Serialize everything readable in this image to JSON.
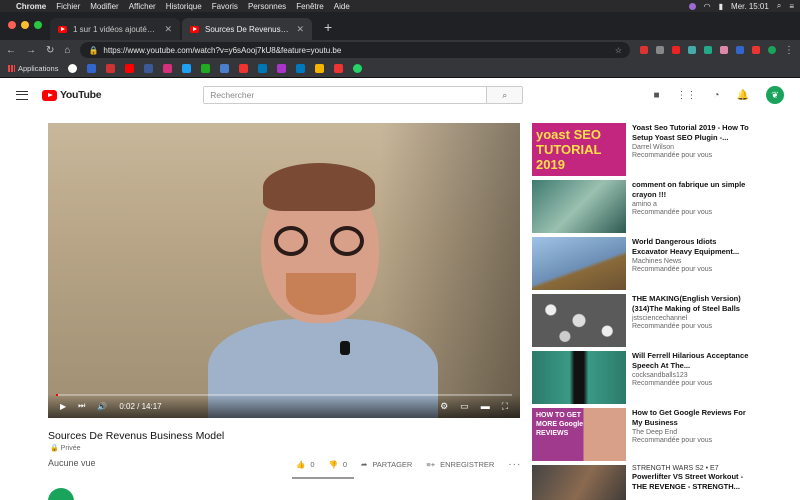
{
  "menubar": {
    "app": "Chrome",
    "items": [
      "Fichier",
      "Modifier",
      "Afficher",
      "Historique",
      "Favoris",
      "Personnes",
      "Fenêtre",
      "Aide"
    ],
    "clock": "Mer. 15:01"
  },
  "tabs": [
    {
      "title": "1 sur 1 vidéos ajoutées - YouTube"
    },
    {
      "title": "Sources De Revenus Business Model - YouTube"
    }
  ],
  "toolbar": {
    "url": "https://www.youtube.com/watch?v=y6sAooj7kU8&feature=youtu.be"
  },
  "bookmarks": {
    "apps_label": "Applications"
  },
  "youtube": {
    "logo_text": "YouTube",
    "search_placeholder": "Rechercher",
    "avatar_letter": "●"
  },
  "player": {
    "time": "0:02 / 14:17",
    "progress": 0.002
  },
  "video": {
    "title": "Sources De Revenus Business Model",
    "privacy": "Privée",
    "views": "Aucune vue",
    "likes": "0",
    "dislikes": "0",
    "share_label": "PARTAGER",
    "save_label": "ENREGISTRER"
  },
  "recommendations": [
    {
      "title": "Yoast Seo Tutorial 2019 - How To Setup Yoast SEO Plugin -...",
      "channel": "Darrel Wilson",
      "meta": "Recommandée pour vous",
      "thumb_text": "yoast SEO TUTORIAL 2019",
      "thumb_color": "#c2267e"
    },
    {
      "title": "comment on fabrique un simple crayon !!!",
      "channel": "amino a",
      "meta": "Recommandée pour vous",
      "thumb_text": "",
      "thumb_color": "#4c8a7c"
    },
    {
      "title": "World Dangerous Idiots Excavator Heavy Equipment...",
      "channel": "Machines News",
      "meta": "Recommandée pour vous",
      "thumb_text": "",
      "thumb_color": "#7aa2c8"
    },
    {
      "title": "THE MAKING(English Version) (314)The Making of Steel Balls",
      "channel": "jstsciencechannel",
      "meta": "Recommandée pour vous",
      "thumb_text": "",
      "thumb_color": "#777777"
    },
    {
      "title": "Will Ferrell Hilarious Acceptance Speech At The...",
      "channel": "cocksandballs123",
      "meta": "Recommandée pour vous",
      "thumb_text": "",
      "thumb_color": "#2c7a6a"
    },
    {
      "title": "How to Get Google Reviews For My Business",
      "channel": "The Deep End",
      "meta": "Recommandée pour vous",
      "thumb_text": "HOW TO GET MORE Google REVIEWS",
      "thumb_color": "#a03a8c"
    },
    {
      "title": "Powerlifter VS Street Workout - THE REVENGE - STRENGTH...",
      "channel": "STRENGTH WARS  S2 • E7",
      "meta": "",
      "thumb_text": "",
      "thumb_color": "#555555"
    }
  ]
}
